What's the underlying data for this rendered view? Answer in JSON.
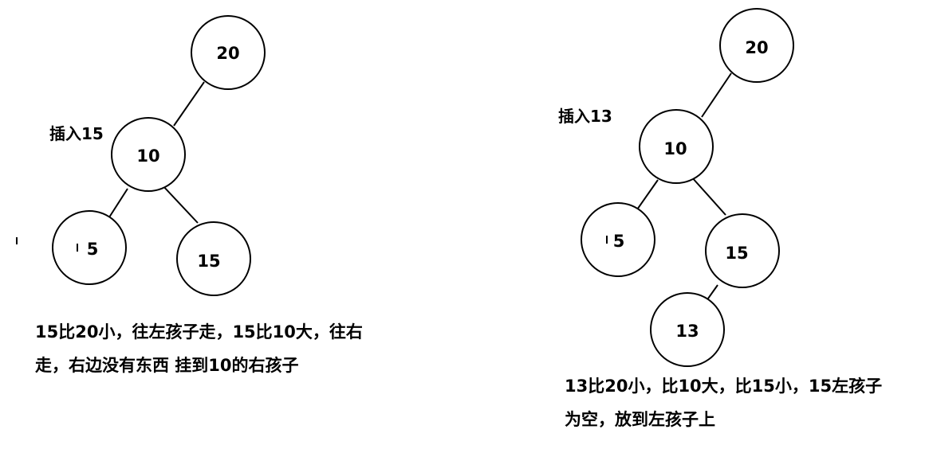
{
  "left_diagram": {
    "insert_label": "插入15",
    "nodes": {
      "root": "20",
      "mid": "10",
      "left": "5",
      "right": "15"
    },
    "caption_lines": [
      "15比20小，往左孩子走，15比10大，往右",
      "走，右边没有东西 挂到10的右孩子"
    ]
  },
  "right_diagram": {
    "insert_label": "插入13",
    "nodes": {
      "root": "20",
      "mid": "10",
      "left": "5",
      "right": "15",
      "new": "13"
    },
    "caption_lines": [
      "13比20小，比10大，比15小，15左孩子",
      "为空，放到左孩子上"
    ]
  }
}
